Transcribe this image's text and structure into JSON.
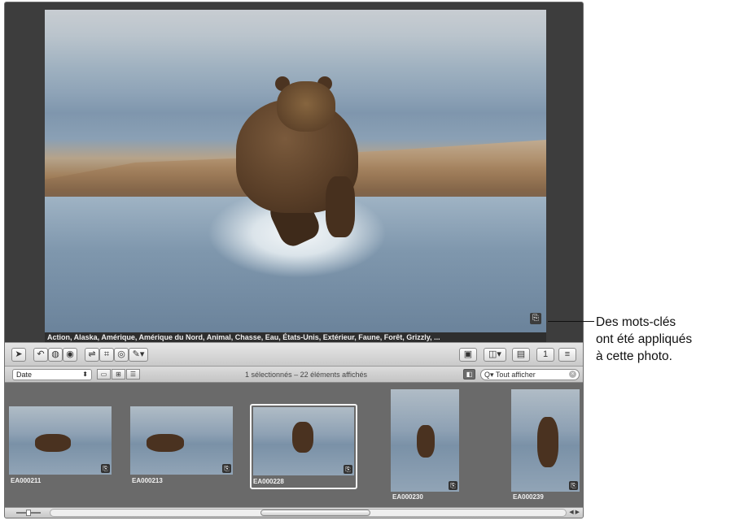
{
  "viewer": {
    "photo_alt": "grizzly bear running in water",
    "caption": "Action, Alaska, Amérique, Amérique du Nord, Animal, Chasse, Eau, États-Unis, Extérieur, Faune, Forêt, Grizzly, ...",
    "keyword_badge_icon": "keyword-tag-icon"
  },
  "toolbar": {
    "left_tools": [
      "arrow-tool-icon",
      "rotate-icon",
      "lift-stamp-icon",
      "stamp-icon",
      "straighten-icon",
      "crop-icon",
      "red-eye-icon",
      "brush-icon"
    ],
    "right_tools": [
      "loupe-icon",
      "adjust-icon",
      "inspector-icon",
      "single-view-icon",
      "list-view-icon"
    ]
  },
  "browser": {
    "sort_value": "Date",
    "view_buttons": [
      "filmstrip-view-icon",
      "grid-view-icon",
      "list-view-icon"
    ],
    "status": "1 sélectionnés – 22 éléments affichés",
    "search_placeholder": "Tout afficher",
    "search_prefix": "Q▾"
  },
  "thumbnails": [
    {
      "id": "EA000211",
      "orientation": "landscape",
      "selected": false
    },
    {
      "id": "EA000213",
      "orientation": "landscape",
      "selected": false
    },
    {
      "id": "EA000228",
      "orientation": "landscape",
      "selected": true
    },
    {
      "id": "EA000230",
      "orientation": "portrait",
      "selected": false
    },
    {
      "id": "EA000239",
      "orientation": "portrait",
      "selected": false
    }
  ],
  "callout": {
    "line1": "Des mots-clés",
    "line2": "ont été appliqués",
    "line3": "à cette photo."
  }
}
